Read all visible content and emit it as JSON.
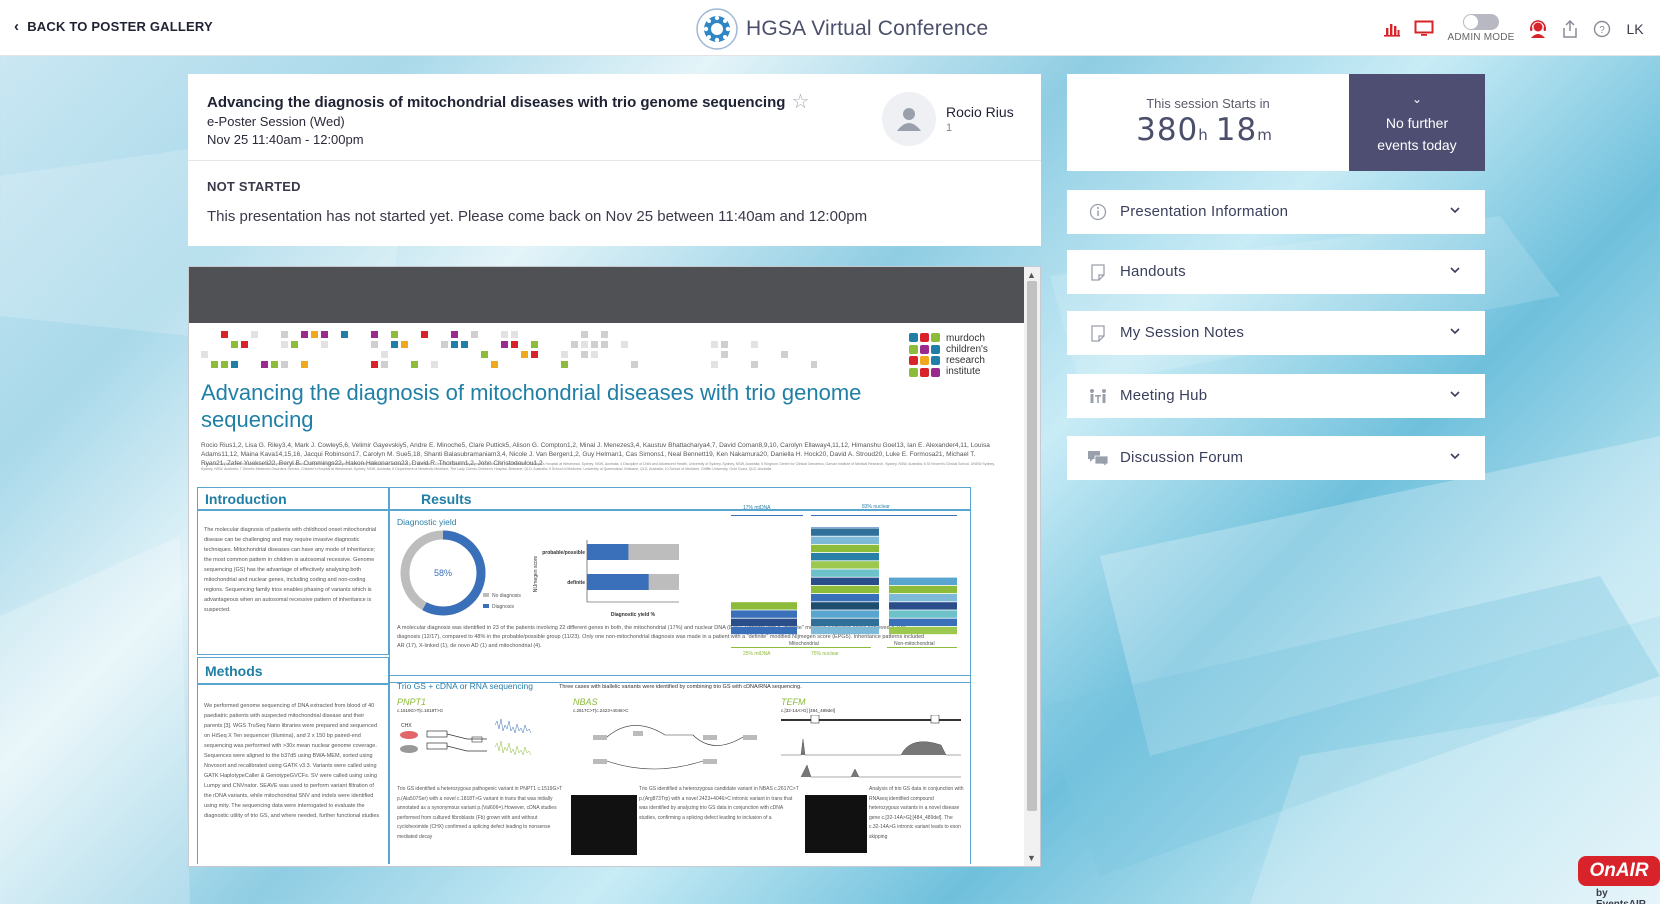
{
  "header": {
    "back_label": "BACK TO POSTER GALLERY",
    "app_title": "HGSA Virtual Conference",
    "admin_mode_label": "ADMIN MODE",
    "user_initials": "LK",
    "icons": [
      "bar-chart-icon",
      "monitor-icon",
      "admin-toggle",
      "support-agent-icon",
      "share-icon",
      "help-icon"
    ]
  },
  "presentation": {
    "title": "Advancing the diagnosis of mitochondrial diseases with trio genome sequencing",
    "session": "e-Poster Session (Wed)",
    "time": "Nov 25 11:40am - 12:00pm",
    "speaker_name": "Rocio Rius",
    "speaker_sub": "1",
    "status_label": "NOT STARTED",
    "status_message": "This presentation has not started yet. Please come back on Nov 25 between 11:40am and 12:00pm"
  },
  "poster": {
    "title": "Advancing the diagnosis of mitochondrial diseases with trio genome sequencing",
    "institute_lines": [
      "murdoch",
      "children's",
      "research",
      "institute"
    ],
    "authors": "Rocio Rius1,2, Lisa G. Riley3,4, Mark J. Cowley5,6, Velimir Gayevskiy5, Andre E. Minoche5, Clare Puttick5, Alison G. Compton1,2, Minal J. Menezes3,4, Kaustuv Bhattacharya4,7, David Coman8,9,10, Carolyn Ellaway4,11,12, Himanshu Goel13, Ian E. Alexander4,11, Louisa Adams11,12, Maina Kava14,15,16, Jacqui Robinson17, Carolyn M. Sue5,18, Shanti Balasubramaniam3,4, Nicole J. Van Bergen1,2, Guy Helman1, Cas Simons1, Neal Bennett19, Ken Nakamura20, Daniella H. Hock20, David A. Stroud20, Luke E. Formosa21, Michael T. Ryan21, Zafer Yuekseli22, Beryl B. Cummings22, Hakon Hakonarson23, David R. Thorburn1,2, John Christodoulou1,2",
    "affiliations": "1 Murdoch Children's Research Institute, Melbourne, VIC, Australia; 2 Department of Paediatrics, University of Melbourne, Melbourne, VIC, Australia; 3 Genetic Metabolic Disorders Research Unit, Kids Research, Children's Hospital at Westmead, Sydney, NSW, Australia; 4 Discipline of Child and Adolescent Health, University of Sydney, Sydney, NSW, Australia; 5 Kinghorn Centre for Clinical Genomics, Garvan Institute of Medical Research, Sydney, NSW, Australia; 6 St Vincent's Clinical School, UNSW Sydney, Sydney, NSW, Australia; 7 Genetic Metabolic Disorders Service, Children's Hospital at Westmead, Sydney, NSW, Australia; 8 Department of Metabolic Medicine, The Lady Cilento Children's Hospital, Brisbane, QLD, Australia; 9 School of Medicine, University of Queensland, Brisbane, QLD, Australia; 10 School of Medicine, Griffith University, Gold Coast, QLD, Australia",
    "intro_heading": "Introduction",
    "results_heading": "Results",
    "methods_heading": "Methods",
    "intro_text": "The molecular diagnosis of patients with childhood onset mitochondrial disease can be challenging and may require invasive diagnostic techniques. Mitochondrial diseases can have any mode of inheritance; the most common pattern in children is autosomal recessive. Genome sequencing (GS) has the advantage of effectively analysing both mitochondrial and nuclear genes, including coding and non-coding regions. Sequencing family trios enables phasing of variants which is advantageous when an autosomal recessive pattern of inheritance is suspected.",
    "methods_text": "We performed genome sequencing of DNA extracted from blood of 40 paediatric patients with suspected mitochondrial disease and their parents [3]. WGS TruSeq Nano libraries were prepared and sequenced on HiSeq X Ten sequencer (Illumina), and 2 x 150 bp paired-end sequencing was performed with >30x mean nuclear genome coverage. Sequences were aligned to the b37d5 using BWA-MEM, sorted using Novosort and recalibrated using GATK v3.3. Variants were called using GATK HaplotypeCaller & GenotypeGVCFs. SV were called using using Lumpy and CNVnator. SEAVE was used to perform variant filtration of the rDNA variants, while mitochondrial SNV and indels were identified using mity. The sequencing data were interrogated to evaluate the diagnostic utility of trio GS, and where needed, further functional studies",
    "diagnostic_yield_label": "Diagnostic yield",
    "donut_value": 58,
    "donut_label": "58%",
    "legend_no_dx": "No diagnosis",
    "legend_dx": "Diagnosis",
    "bar_y_label": "NIJmegen score",
    "bar_x_label": "Diagnostic yield %",
    "bars": [
      {
        "label": "probable/possible",
        "value": 45
      },
      {
        "label": "definite",
        "value": 67
      }
    ],
    "results_text": "A molecular diagnosis was identified in 23 of the patients involving 22 different genes in both, the mitochondrial (17%) and nuclear DNA (83%). Patients with a \"definite\" modified NIjmegen score achieved a 70% diagnosis (12/17), compared to 48% in the probable/possible group (11/23). Only one non-mitochondrial diagnosis was made in a patient with a \"definite\" modified NIjmegen score (EPG5). Inheritance patterns included AR (17), X-linked (1), de novo AD (1) and mitochondrial (4).",
    "stack_head_mt": "17% mtDNA",
    "stack_head_nuc": "83% nuclear",
    "stack_foot_mt": "25% mtDNA",
    "stack_foot_nuc": "75% nuclear",
    "stack_label_mito": "Mitochondrial",
    "stack_label_nonmito": "Non-mitochondrial",
    "trio_heading": "Trio GS + cDNA or RNA sequencing",
    "trio_subtitle": "Three cases with biallelic variants were identified by combining trio GS with cDNA/RNA sequencing.",
    "gene1": "PNPT1",
    "gene1_variant": "c.1519G>T|c.1818T>G",
    "gene2": "NBAS",
    "gene2_variant": "c.2617C>T|c.2423+4046>C",
    "gene3": "TEFM",
    "gene3_variant": "c.[32-14A>G] [484_489del]",
    "gene1_text": "Trio GS identified a heterozygous pathogenic variant in PNPT1 c.1519G>T p.(Ala507Ser) with a novel c.1818T>G variant in trans that was initially annotated as a synonymous variant p.(Val606=).However, cDNA studies performed from cultured fibroblasts (Fb) grown with and without cycloheximide (CHX) confirmed a splicing defect leading to nonsense mediated decay",
    "gene2_text": "Trio GS identified a heterozygous candidate variant in NBAS c.2617C>T p.(Arg873Trp) with a novel 2423+4046>C intronic variant in trans that was identified by analyzing trio GS data in conjunction with cDNA studies, confirming a splicing defect leading to inclusion of a",
    "gene3_text": "Analysis of trio GS data in conjunction with RNAseq identified compound heterozygous variants in a novel disease gene c.[32-14A>G];[484_489del]. The c.32-14A>G intronic variant leads to exon skipping"
  },
  "countdown": {
    "label": "This session Starts in",
    "hours": "380",
    "hours_unit": "h",
    "minutes": "18",
    "minutes_unit": "m",
    "events_line1": "No further",
    "events_line2": "events today"
  },
  "accordion": [
    {
      "label": "Presentation Information",
      "icon": "info-icon"
    },
    {
      "label": "Handouts",
      "icon": "note-icon"
    },
    {
      "label": "My Session Notes",
      "icon": "note-icon"
    },
    {
      "label": "Meeting Hub",
      "icon": "meeting-icon"
    },
    {
      "label": "Discussion Forum",
      "icon": "chat-icon"
    }
  ],
  "onair": {
    "label": "OnAIR",
    "by": "by EventsAIR"
  },
  "colors": {
    "accent_purple": "#4d4e72",
    "poster_blue": "#1f7fa6",
    "poster_green": "#8dbb3a",
    "red_icon": "#d8232a"
  }
}
